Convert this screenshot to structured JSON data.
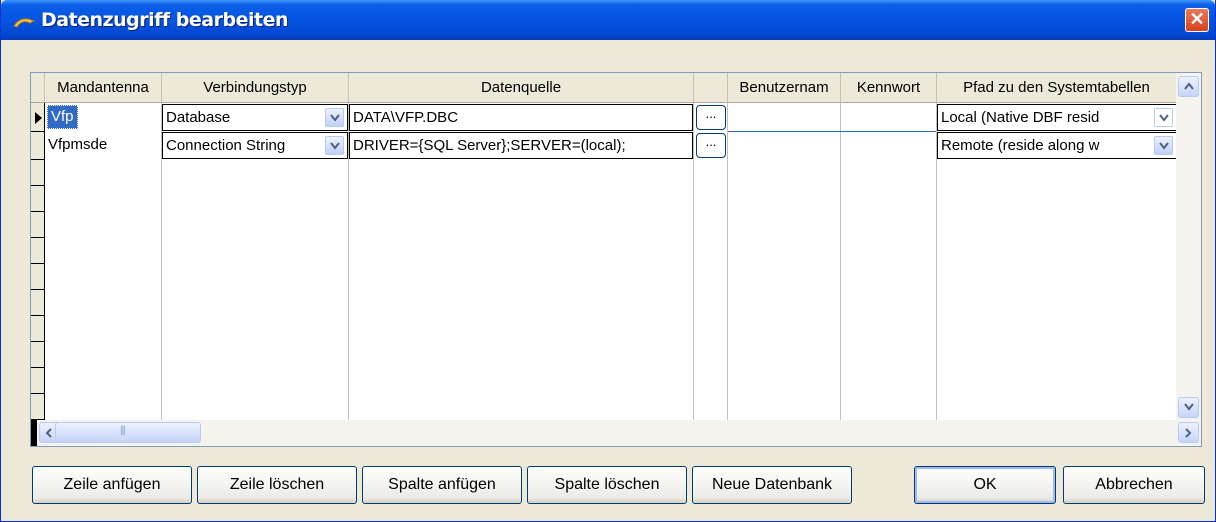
{
  "window": {
    "title": "Datenzugriff bearbeiten",
    "close_label": "✕"
  },
  "grid": {
    "columns": [
      "Mandantenna",
      "Verbindungstyp",
      "Datenquelle",
      "",
      "Benutzernam",
      "Kennwort",
      "Pfad zu den Systemtabellen"
    ],
    "rows": [
      {
        "mandant": "Vfp",
        "verbindungstyp": "Database",
        "datenquelle": "DATA\\VFP.DBC",
        "browse": "...",
        "benutzername": "",
        "kennwort": "",
        "pfad": "Local (Native DBF resid"
      },
      {
        "mandant": "Vfpmsde",
        "verbindungstyp": "Connection String",
        "datenquelle": "DRIVER={SQL Server};SERVER=(local);",
        "browse": "...",
        "benutzername": "",
        "kennwort": "",
        "pfad": "Remote (reside along w"
      }
    ],
    "hscroll_grip": "|||"
  },
  "buttons": {
    "zeile_anfuegen": "Zeile anfügen",
    "zeile_loeschen": "Zeile löschen",
    "spalte_anfuegen": "Spalte anfügen",
    "spalte_loeschen": "Spalte löschen",
    "neue_datenbank": "Neue Datenbank",
    "ok": "OK",
    "abbrechen": "Abbrechen"
  },
  "colors": {
    "titlebar": "#0554e3",
    "selection": "#316ac5",
    "close": "#d7431f"
  }
}
